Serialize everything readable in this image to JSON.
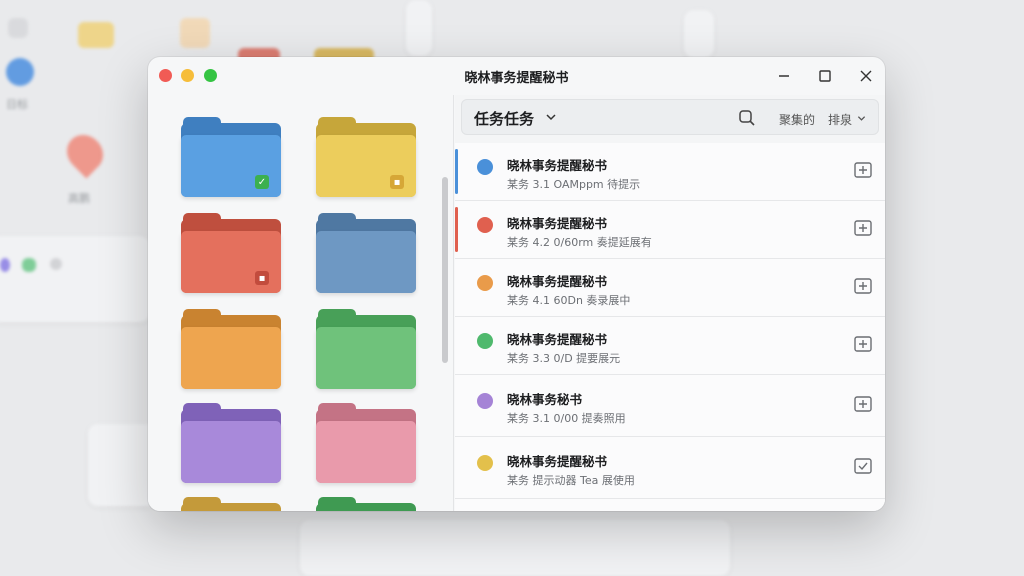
{
  "window": {
    "title": "晓林事务提醒秘书"
  },
  "toolbar": {
    "title": "任务任务",
    "sort_label": "聚集的",
    "filter_label": "排泉"
  },
  "tasks": [
    {
      "name": "晓林事务提醒秘书",
      "subtitle": "某务 3.1 OAMppm 待提示",
      "color": "#4a90d9",
      "accent": "#4a90d9"
    },
    {
      "name": "晓林事务提醒秘书",
      "subtitle": "某务 4.2 0/60rm 奏提延展有",
      "color": "#e0604f",
      "accent": "#e0604f"
    },
    {
      "name": "晓林事务提醒秘书",
      "subtitle": "某务 4.1 60Dn 奏录展中",
      "color": "#e99b4a",
      "accent": ""
    },
    {
      "name": "晓林事务提醒秘书",
      "subtitle": "某务 3.3 0/D 提要展元",
      "color": "#4fb96d",
      "accent": ""
    },
    {
      "name": "晓林事务秘书",
      "subtitle": "某务 3.1 0/00 提奏照用",
      "color": "#a583d6",
      "accent": ""
    },
    {
      "name": "晓林事务提醒秘书",
      "subtitle": "某务 提示动器 Tea 展使用",
      "color": "#e3c04b",
      "accent": ""
    }
  ],
  "folders": [
    {
      "name": "folder-blue",
      "color": "#5aa0e2",
      "tab": "#3f7fc0",
      "badge": "check-icon",
      "badge_color": "#3cb04f"
    },
    {
      "name": "folder-yellow",
      "color": "#eccd5c",
      "tab": "#c6a63a",
      "badge": "doc-icon",
      "badge_color": "#d6a737"
    },
    {
      "name": "folder-red",
      "color": "#e4705d",
      "tab": "#bf4f3e",
      "badge": "doc-icon",
      "badge_color": "#c24c3d"
    },
    {
      "name": "folder-steel",
      "color": "#6e98c3",
      "tab": "#4f78a2",
      "badge": "",
      "badge_color": ""
    },
    {
      "name": "folder-orange",
      "color": "#eea54f",
      "tab": "#c98330",
      "badge": "",
      "badge_color": ""
    },
    {
      "name": "folder-green",
      "color": "#6fc27b",
      "tab": "#48a058",
      "badge": "",
      "badge_color": ""
    },
    {
      "name": "folder-purple",
      "color": "#a889da",
      "tab": "#7f62b8",
      "badge": "",
      "badge_color": ""
    },
    {
      "name": "folder-pink",
      "color": "#e99aab",
      "tab": "#c47385",
      "badge": "",
      "badge_color": ""
    }
  ],
  "background": {
    "label_top": "日标",
    "label_mid": "高鹏"
  }
}
